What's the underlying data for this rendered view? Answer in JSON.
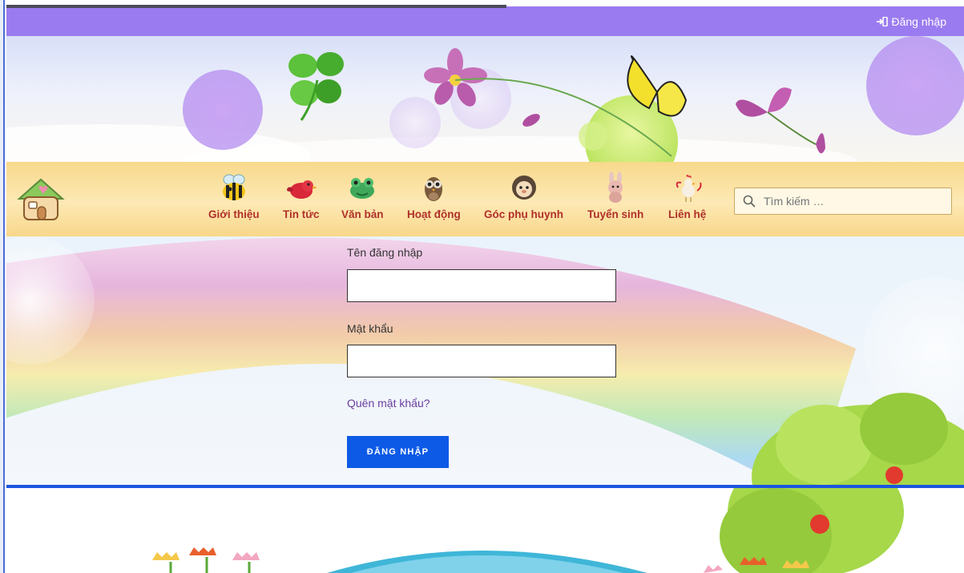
{
  "topbar": {
    "login_label": "Đăng nhập"
  },
  "nav": {
    "items": [
      {
        "label": "Giới thiệu",
        "icon": "bee-icon"
      },
      {
        "label": "Tin tức",
        "icon": "bird-icon"
      },
      {
        "label": "Văn bản",
        "icon": "frog-icon"
      },
      {
        "label": "Hoạt động",
        "icon": "owl-icon"
      },
      {
        "label": "Góc phụ huynh",
        "icon": "hedgehog-icon"
      },
      {
        "label": "Tuyển sinh",
        "icon": "rabbit-icon"
      },
      {
        "label": "Liên hệ",
        "icon": "rooster-icon"
      }
    ],
    "search_placeholder": "Tìm kiếm …"
  },
  "form": {
    "username_label": "Tên đăng nhập",
    "password_label": "Mật khẩu",
    "forgot_label": "Quên mật khẩu?",
    "submit_label": "ĐĂNG NHẬP"
  },
  "colors": {
    "topbar": "#9b7bf0",
    "nav_text": "#b0302a",
    "button": "#0d5ae6",
    "divider": "#1c55e0",
    "link": "#6b3da0"
  }
}
